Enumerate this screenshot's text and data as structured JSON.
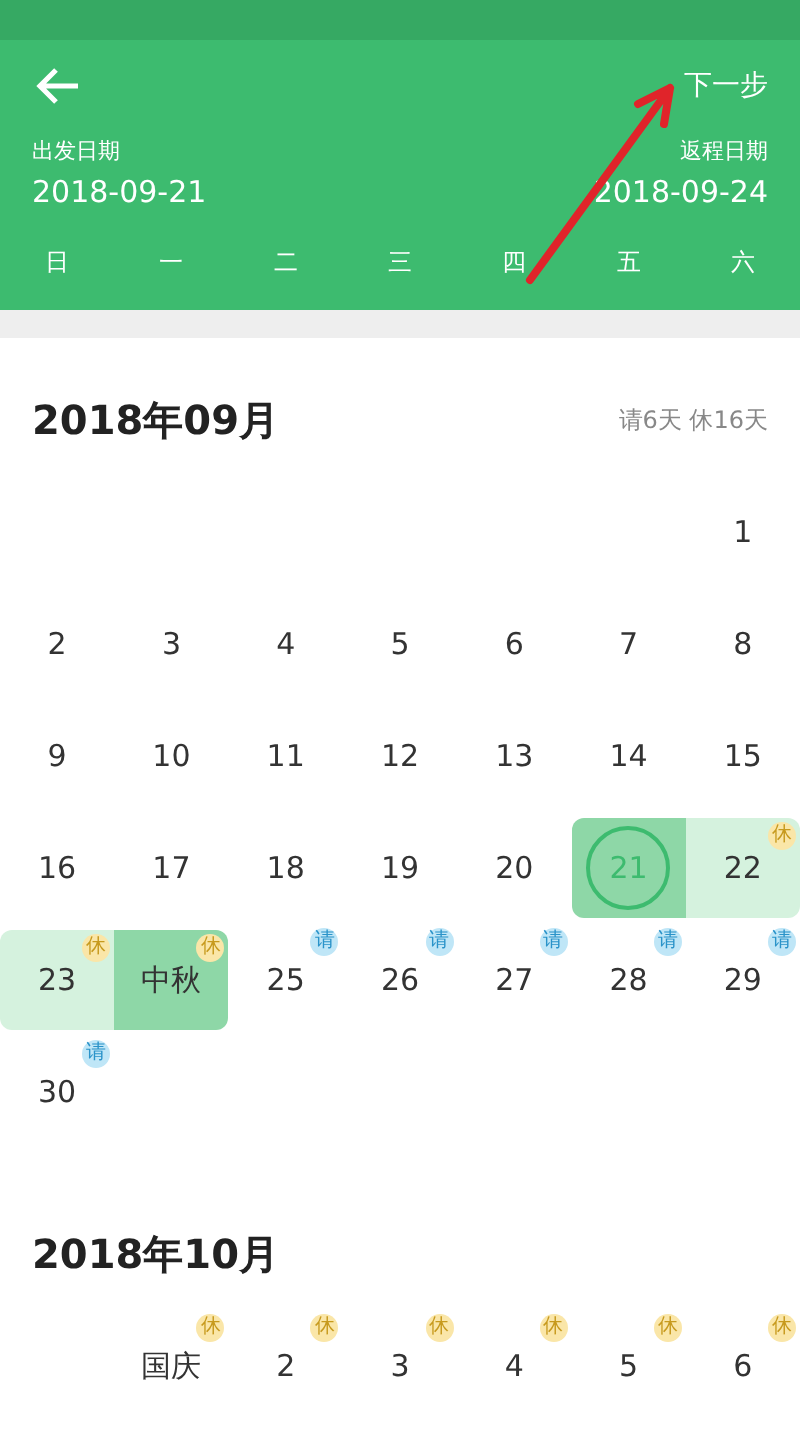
{
  "header": {
    "next_label": "下一步",
    "depart": {
      "label": "出发日期",
      "date": "2018-09-21"
    },
    "return": {
      "label": "返程日期",
      "date": "2018-09-24"
    },
    "weekdays": [
      "日",
      "一",
      "二",
      "三",
      "四",
      "五",
      "六"
    ]
  },
  "months": [
    {
      "title": "2018年09月",
      "summary": "请6天 休16天",
      "weeks": [
        [
          {
            "kind": "blank"
          },
          {
            "kind": "blank"
          },
          {
            "kind": "blank"
          },
          {
            "kind": "blank"
          },
          {
            "kind": "blank"
          },
          {
            "kind": "blank"
          },
          {
            "kind": "day",
            "label": "1",
            "selected": false,
            "in_range": false,
            "circled": false
          }
        ],
        [
          {
            "kind": "day",
            "label": "2",
            "selected": false,
            "in_range": false,
            "circled": false
          },
          {
            "kind": "day",
            "label": "3",
            "selected": false,
            "in_range": false,
            "circled": false
          },
          {
            "kind": "day",
            "label": "4",
            "selected": false,
            "in_range": false,
            "circled": false
          },
          {
            "kind": "day",
            "label": "5",
            "selected": false,
            "in_range": false,
            "circled": false
          },
          {
            "kind": "day",
            "label": "6",
            "selected": false,
            "in_range": false,
            "circled": false
          },
          {
            "kind": "day",
            "label": "7",
            "selected": false,
            "in_range": false,
            "circled": false
          },
          {
            "kind": "day",
            "label": "8",
            "selected": false,
            "in_range": false,
            "circled": false
          }
        ],
        [
          {
            "kind": "day",
            "label": "9",
            "selected": false,
            "in_range": false,
            "circled": false
          },
          {
            "kind": "day",
            "label": "10",
            "selected": false,
            "in_range": false,
            "circled": false
          },
          {
            "kind": "day",
            "label": "11",
            "selected": false,
            "in_range": false,
            "circled": false
          },
          {
            "kind": "day",
            "label": "12",
            "selected": false,
            "in_range": false,
            "circled": false
          },
          {
            "kind": "day",
            "label": "13",
            "selected": false,
            "in_range": false,
            "circled": false
          },
          {
            "kind": "day",
            "label": "14",
            "selected": false,
            "in_range": false,
            "circled": false
          },
          {
            "kind": "day",
            "label": "15",
            "selected": false,
            "in_range": false,
            "circled": false
          }
        ],
        [
          {
            "kind": "day",
            "label": "16",
            "selected": false,
            "in_range": false,
            "circled": false
          },
          {
            "kind": "day",
            "label": "17",
            "selected": false,
            "in_range": false,
            "circled": false
          },
          {
            "kind": "day",
            "label": "18",
            "selected": false,
            "in_range": false,
            "circled": false
          },
          {
            "kind": "day",
            "label": "19",
            "selected": false,
            "in_range": false,
            "circled": false
          },
          {
            "kind": "day",
            "label": "20",
            "selected": false,
            "in_range": false,
            "circled": false
          },
          {
            "kind": "day",
            "label": "21",
            "selected": true,
            "in_range": false,
            "circled": true
          },
          {
            "kind": "day",
            "label": "22",
            "badge": {
              "kind": "rest",
              "text": "休"
            },
            "selected": false,
            "in_range": true,
            "circled": false
          }
        ],
        [
          {
            "kind": "day",
            "label": "23",
            "badge": {
              "kind": "rest",
              "text": "休"
            },
            "selected": false,
            "in_range": true,
            "circled": false
          },
          {
            "kind": "day",
            "label": "中秋",
            "badge": {
              "kind": "rest",
              "text": "休"
            },
            "selected": true,
            "in_range": false,
            "circled": false
          },
          {
            "kind": "day",
            "label": "25",
            "badge": {
              "kind": "leave",
              "text": "请"
            },
            "selected": false,
            "in_range": false,
            "circled": false
          },
          {
            "kind": "day",
            "label": "26",
            "badge": {
              "kind": "leave",
              "text": "请"
            },
            "selected": false,
            "in_range": false,
            "circled": false
          },
          {
            "kind": "day",
            "label": "27",
            "badge": {
              "kind": "leave",
              "text": "请"
            },
            "selected": false,
            "in_range": false,
            "circled": false
          },
          {
            "kind": "day",
            "label": "28",
            "badge": {
              "kind": "leave",
              "text": "请"
            },
            "selected": false,
            "in_range": false,
            "circled": false
          },
          {
            "kind": "day",
            "label": "29",
            "badge": {
              "kind": "leave",
              "text": "请"
            },
            "selected": false,
            "in_range": false,
            "circled": false
          }
        ],
        [
          {
            "kind": "day",
            "label": "30",
            "badge": {
              "kind": "leave",
              "text": "请"
            },
            "selected": false,
            "in_range": false,
            "circled": false
          }
        ]
      ]
    },
    {
      "title": "2018年10月",
      "weeks": [
        [
          {
            "kind": "blank"
          },
          {
            "kind": "day",
            "label": "国庆",
            "badge": {
              "kind": "rest",
              "text": "休"
            },
            "selected": false,
            "in_range": false,
            "circled": false
          },
          {
            "kind": "day",
            "label": "2",
            "badge": {
              "kind": "rest",
              "text": "休"
            },
            "selected": false,
            "in_range": false,
            "circled": false
          },
          {
            "kind": "day",
            "label": "3",
            "badge": {
              "kind": "rest",
              "text": "休"
            },
            "selected": false,
            "in_range": false,
            "circled": false
          },
          {
            "kind": "day",
            "label": "4",
            "badge": {
              "kind": "rest",
              "text": "休"
            },
            "selected": false,
            "in_range": false,
            "circled": false
          },
          {
            "kind": "day",
            "label": "5",
            "badge": {
              "kind": "rest",
              "text": "休"
            },
            "selected": false,
            "in_range": false,
            "circled": false
          },
          {
            "kind": "day",
            "label": "6",
            "badge": {
              "kind": "rest",
              "text": "休"
            },
            "selected": false,
            "in_range": false,
            "circled": false
          }
        ]
      ]
    }
  ]
}
